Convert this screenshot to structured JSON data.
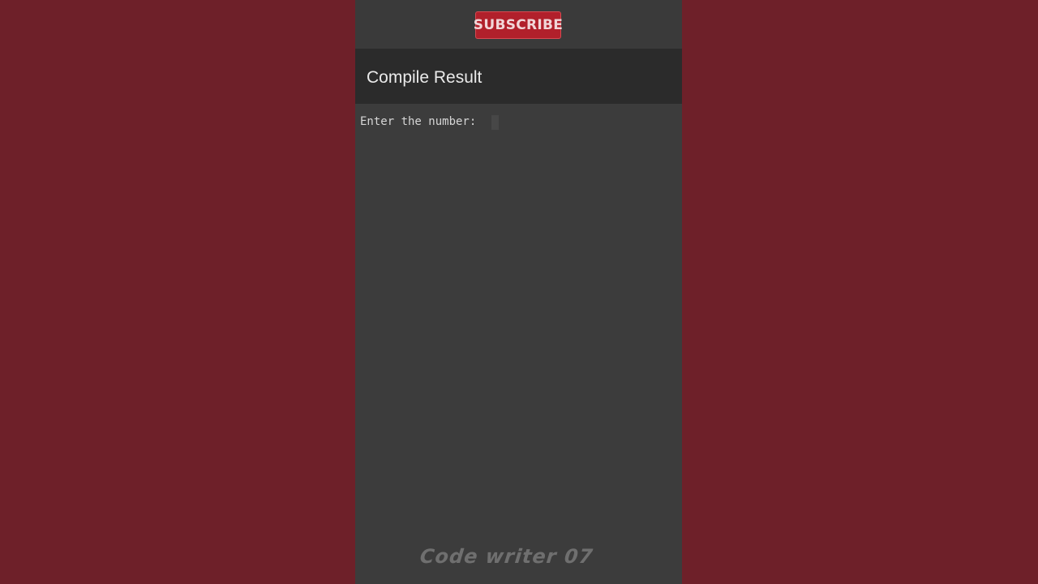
{
  "promo": {
    "subscribe_label": "SUBSCRIBE"
  },
  "app_bar": {
    "title": "Compile Result"
  },
  "console": {
    "output_line": "Enter the number: "
  },
  "watermark": {
    "text": "Code writer 07"
  },
  "colors": {
    "background": "#6e2029",
    "phone_surface": "#3c3c3c",
    "app_bar": "#2b2b2b",
    "subscribe_button": "#b1202b"
  }
}
